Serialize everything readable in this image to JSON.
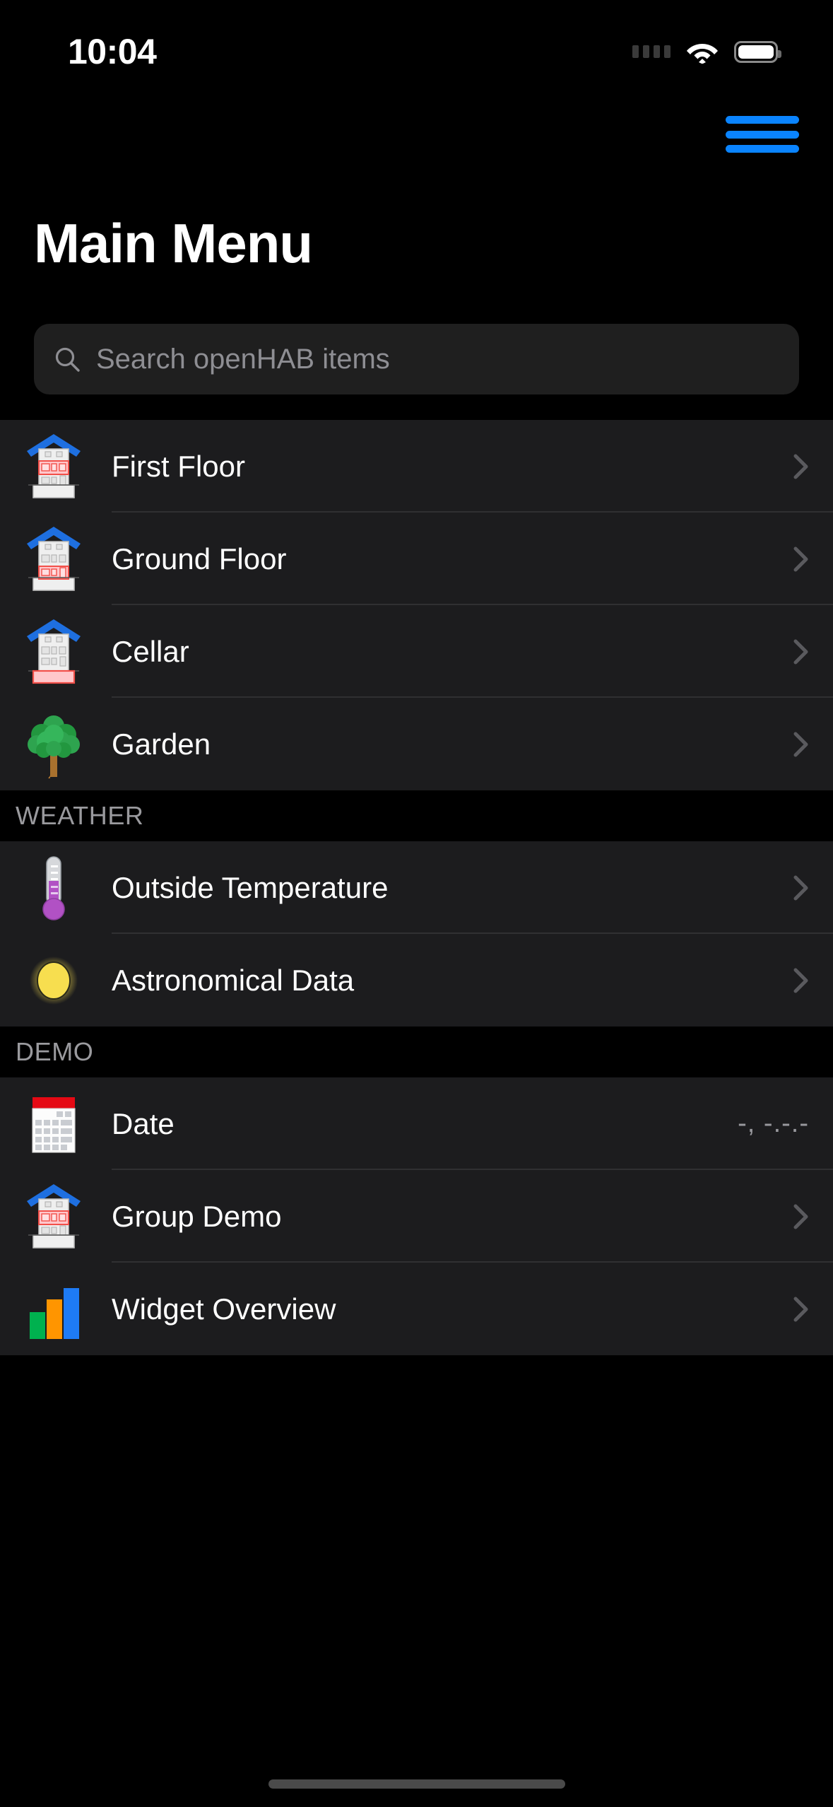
{
  "status_bar": {
    "time": "10:04",
    "cellular_icon": "cellular-dots-icon",
    "wifi_icon": "wifi-icon",
    "battery_icon": "battery-full-icon"
  },
  "nav": {
    "menu_icon": "hamburger-menu-icon",
    "menu_color": "#0A84FF"
  },
  "header": {
    "title": "Main Menu"
  },
  "search": {
    "icon": "search-icon",
    "placeholder": "Search openHAB items",
    "value": ""
  },
  "sections": [
    {
      "header": "",
      "items": [
        {
          "label": "First Floor",
          "icon": "house-first-floor-icon",
          "value": "",
          "accessory": "chevron-right-icon"
        },
        {
          "label": "Ground Floor",
          "icon": "house-ground-floor-icon",
          "value": "",
          "accessory": "chevron-right-icon"
        },
        {
          "label": "Cellar",
          "icon": "house-cellar-icon",
          "value": "",
          "accessory": "chevron-right-icon"
        },
        {
          "label": "Garden",
          "icon": "tree-icon",
          "value": "",
          "accessory": "chevron-right-icon"
        }
      ]
    },
    {
      "header": "WEATHER",
      "items": [
        {
          "label": "Outside Temperature",
          "icon": "thermometer-icon",
          "value": "",
          "accessory": "chevron-right-icon"
        },
        {
          "label": "Astronomical Data",
          "icon": "sun-icon",
          "value": "",
          "accessory": "chevron-right-icon"
        }
      ]
    },
    {
      "header": "DEMO",
      "items": [
        {
          "label": "Date",
          "icon": "calendar-icon",
          "value": "-, -.-.-",
          "accessory": ""
        },
        {
          "label": "Group Demo",
          "icon": "house-group-icon",
          "value": "",
          "accessory": "chevron-right-icon"
        },
        {
          "label": "Widget Overview",
          "icon": "bar-chart-icon",
          "value": "",
          "accessory": "chevron-right-icon"
        }
      ]
    }
  ],
  "colors": {
    "accent": "#0A84FF",
    "row_background": "#1C1C1E",
    "page_background": "#000000",
    "separator": "#303032",
    "secondary_text": "#98989D",
    "roof_blue": "#1E6FE0",
    "highlight_pink": "#FFC7CB",
    "highlight_red": "#F2504A",
    "tree_green": "#2EA44F",
    "thermo_purple": "#B151C4",
    "sun_yellow": "#F7DE4F",
    "calendar_red": "#E50914",
    "bar_green": "#00B14F",
    "bar_orange": "#FF9500",
    "bar_blue": "#1E7BF5"
  },
  "home_indicator": "home-indicator"
}
